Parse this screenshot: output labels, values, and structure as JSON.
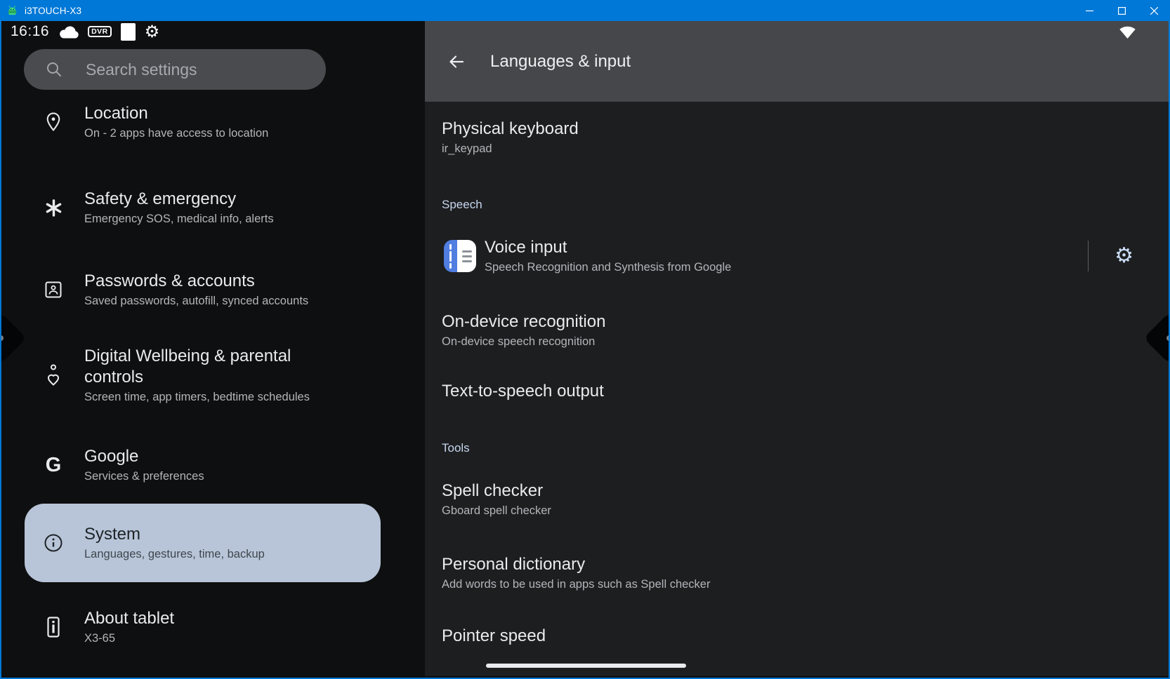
{
  "window": {
    "title": "i3TOUCH-X3",
    "controls": [
      {
        "name": "minimize",
        "icon": "minimize-icon"
      },
      {
        "name": "maximize",
        "icon": "maximize-icon"
      },
      {
        "name": "close",
        "icon": "close-icon"
      }
    ]
  },
  "status_bar": {
    "time": "16:16",
    "dvr_badge_label": "DVR",
    "left_icons": [
      "cloud-icon",
      "dvr-icon",
      "white-square-icon",
      "android-gear-icon"
    ],
    "right_icons": [
      "wifi-icon"
    ]
  },
  "sidebar": {
    "search": {
      "placeholder": "Search settings",
      "icon": "search-icon"
    },
    "items": [
      {
        "icon": "location-pin-icon",
        "label": "Location",
        "subtitle": "On - 2 apps have access to location",
        "selected": false
      },
      {
        "icon": "asterisk-icon",
        "label": "Safety & emergency",
        "subtitle": "Emergency SOS, medical info, alerts",
        "selected": false
      },
      {
        "icon": "id-card-person-icon",
        "label": "Passwords & accounts",
        "subtitle": "Saved passwords, autofill, synced accounts",
        "selected": false
      },
      {
        "icon": "wellbeing-heart-icon",
        "label": "Digital Wellbeing & parental controls",
        "subtitle": "Screen time, app timers, bedtime schedules",
        "selected": false
      },
      {
        "icon": "google-g-icon",
        "label": "Google",
        "subtitle": "Services & preferences",
        "selected": false
      },
      {
        "icon": "info-circle-icon",
        "label": "System",
        "subtitle": "Languages, gestures, time, backup",
        "selected": true
      },
      {
        "icon": "tablet-icon",
        "label": "About tablet",
        "subtitle": "X3-65",
        "selected": false
      }
    ]
  },
  "detail": {
    "back_icon": "back-arrow-icon",
    "title": "Languages & input",
    "rows": [
      {
        "type": "item",
        "title": "Physical keyboard",
        "subtitle": "ir_keypad"
      },
      {
        "type": "section",
        "label": "Speech"
      },
      {
        "type": "item",
        "title": "Voice input",
        "subtitle": "Speech Recognition and Synthesis from Google",
        "leading_icon": "voice-input-app-icon",
        "trailing_icon": "settings-gear-icon",
        "has_divider": true
      },
      {
        "type": "item",
        "title": "On-device recognition",
        "subtitle": "On-device speech recognition"
      },
      {
        "type": "item",
        "title": "Text-to-speech output",
        "subtitle": ""
      },
      {
        "type": "section",
        "label": "Tools"
      },
      {
        "type": "item",
        "title": "Spell checker",
        "subtitle": "Gboard spell checker"
      },
      {
        "type": "item",
        "title": "Personal dictionary",
        "subtitle": "Add words to be used in apps such as Spell checker"
      },
      {
        "type": "item",
        "title": "Pointer speed",
        "subtitle": ""
      }
    ]
  },
  "colors": {
    "titlebar_blue": "#0078d7",
    "sidebar_bg": "#0e0f10",
    "detail_bg": "#1d1e20",
    "detail_header_bg": "#46474a",
    "selected_pill": "#b8c5d8",
    "section_label": "#c6d6ee",
    "voice_icon_blue": "#4f7ee0",
    "gear_icon_blue": "#cadcf5"
  }
}
